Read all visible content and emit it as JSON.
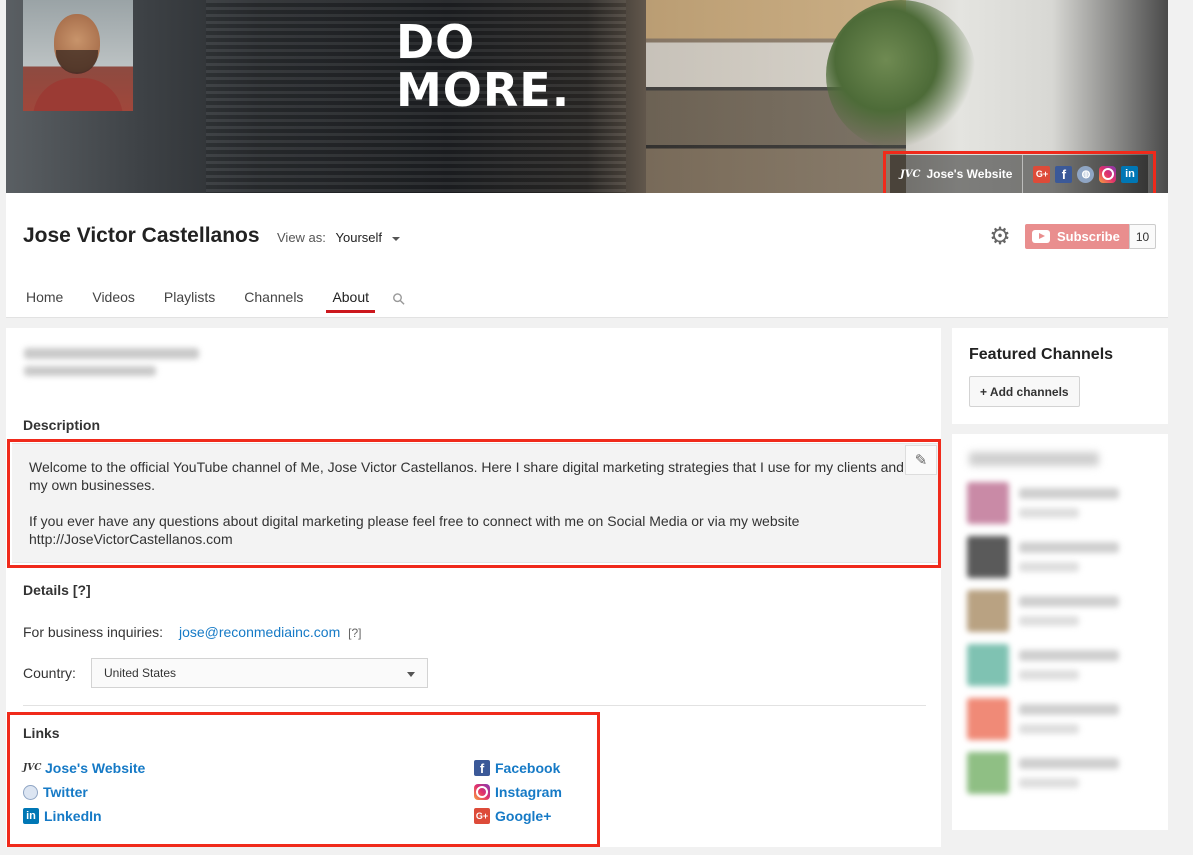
{
  "banner": {
    "tagline": "DO\nMORE.",
    "website_label": "Jose's Website",
    "website_logo": "JVC",
    "social_icons": [
      "google-plus-icon",
      "facebook-icon",
      "globe-icon",
      "instagram-icon",
      "linkedin-icon"
    ]
  },
  "channel": {
    "name": "Jose Victor Castellanos",
    "view_as_label": "View as:",
    "view_as_value": "Yourself",
    "subscribe_label": "Subscribe",
    "subscriber_count": "10"
  },
  "tabs": [
    {
      "label": "Home"
    },
    {
      "label": "Videos"
    },
    {
      "label": "Playlists"
    },
    {
      "label": "Channels"
    },
    {
      "label": "About",
      "active": true
    }
  ],
  "about": {
    "description_title": "Description",
    "description_text": "Welcome to the official YouTube channel of Me, Jose Victor Castellanos. Here I share digital marketing strategies that I use for my clients and\nmy own businesses.\n\nIf you ever have any questions about digital marketing please feel free to connect with me on Social Media or via my website\nhttp://JoseVictorCastellanos.com",
    "details_title": "Details",
    "details_help": "[?]",
    "business_label": "For business inquiries:",
    "business_email": "jose@reconmediainc.com",
    "business_help": "[?]",
    "country_label": "Country:",
    "country_value": "United States",
    "links_title": "Links",
    "links_left": [
      "Jose's Website",
      "Twitter",
      "LinkedIn"
    ],
    "links_right": [
      "Facebook",
      "Instagram",
      "Google+"
    ]
  },
  "sidebar": {
    "featured_title": "Featured Channels",
    "add_channels_label": "+ Add channels"
  },
  "colors": {
    "accent_red": "#cc181e",
    "link_blue": "#167ac6",
    "highlight_box": "#f02a1b",
    "subscribe_bg": "#e98e8e"
  }
}
